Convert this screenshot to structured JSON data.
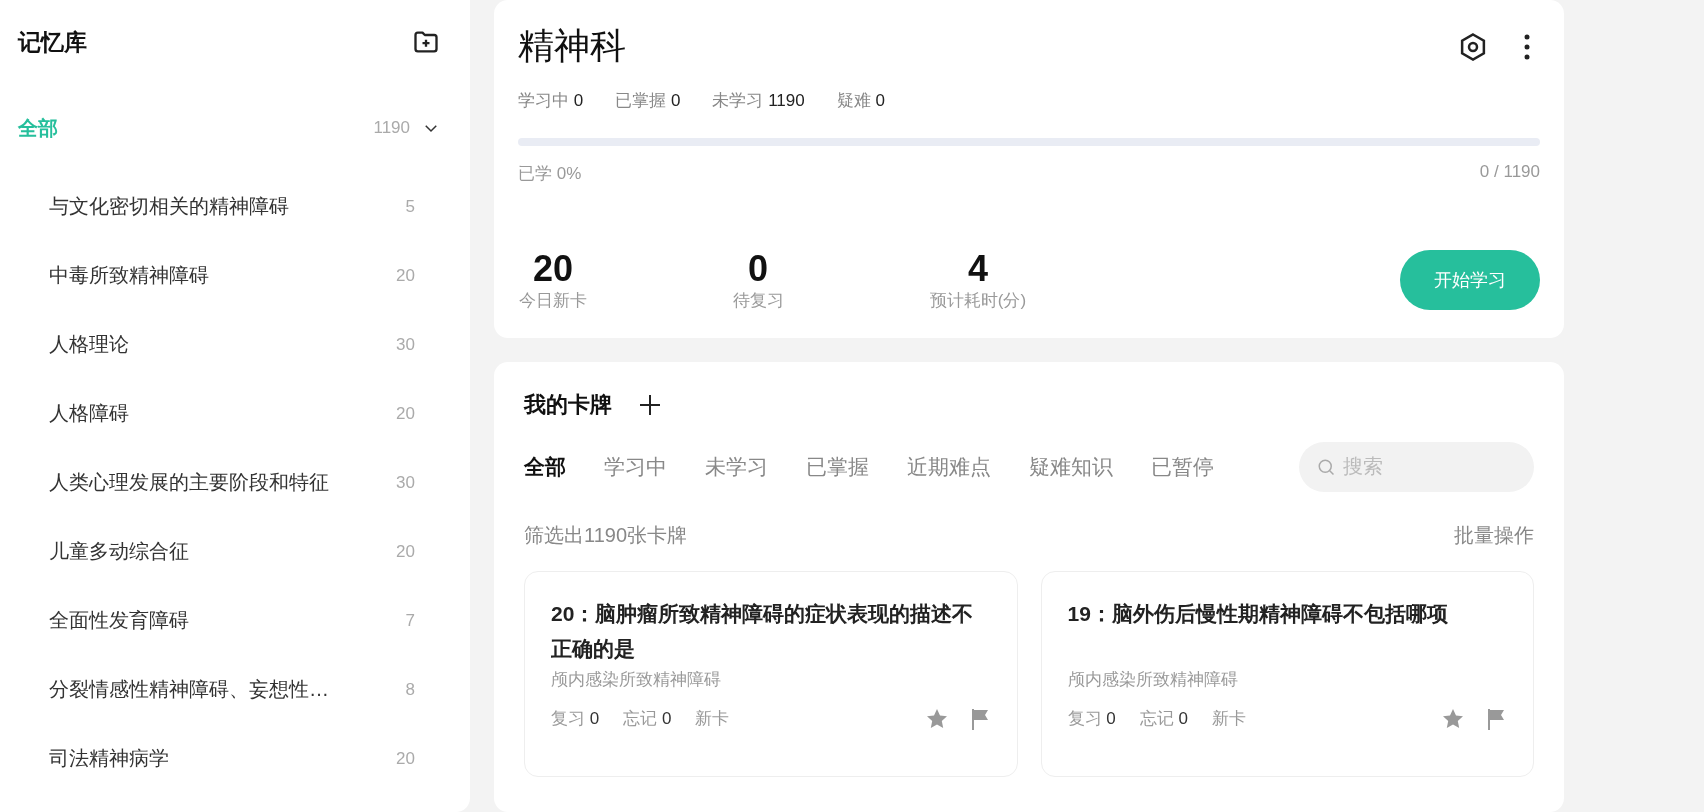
{
  "sidebar": {
    "title": "记忆库",
    "all": {
      "label": "全部",
      "count": "1190",
      "selected": true,
      "expanded": true
    },
    "items": [
      {
        "label": "与文化密切相关的精神障碍",
        "count": "5",
        "selected": false
      },
      {
        "label": "中毒所致精神障碍",
        "count": "20",
        "selected": false
      },
      {
        "label": "人格理论",
        "count": "30",
        "selected": false
      },
      {
        "label": "人格障碍",
        "count": "20",
        "selected": false
      },
      {
        "label": "人类心理发展的主要阶段和特征",
        "count": "30",
        "selected": false
      },
      {
        "label": "儿童多动综合征",
        "count": "20",
        "selected": false
      },
      {
        "label": "全面性发育障碍",
        "count": "7",
        "selected": false
      },
      {
        "label": "分裂情感性精神障碍、妄想性…",
        "count": "8",
        "selected": false
      },
      {
        "label": "司法精神病学",
        "count": "20",
        "selected": false
      }
    ]
  },
  "deck": {
    "title": "精神科",
    "stats": [
      {
        "label": "学习中",
        "value": "0"
      },
      {
        "label": "已掌握",
        "value": "0"
      },
      {
        "label": "未学习",
        "value": "1190"
      },
      {
        "label": "疑难",
        "value": "0"
      }
    ],
    "progress": {
      "level": 0,
      "label": "已学 0%",
      "reading": "0 / 1190"
    },
    "metrics": [
      {
        "value": "20",
        "label": "今日新卡"
      },
      {
        "value": "0",
        "label": "待复习"
      },
      {
        "value": "4",
        "label": "预计耗时(分)"
      }
    ],
    "start_button": "开始学习"
  },
  "cards_panel": {
    "title": "我的卡牌",
    "tabs": [
      {
        "label": "全部",
        "selected": true
      },
      {
        "label": "学习中",
        "selected": false
      },
      {
        "label": "未学习",
        "selected": false
      },
      {
        "label": "已掌握",
        "selected": false
      },
      {
        "label": "近期难点",
        "selected": false
      },
      {
        "label": "疑难知识",
        "selected": false
      },
      {
        "label": "已暂停",
        "selected": false
      }
    ],
    "search": {
      "placeholder": "搜索"
    },
    "filter_count": "筛选出1190张卡牌",
    "batch_action": "批量操作",
    "cards": [
      {
        "title": "20：脑肿瘤所致精神障碍的症状表现的描述不正确的是",
        "category": "颅内感染所致精神障碍",
        "reviews": {
          "label": "复习",
          "value": "0"
        },
        "forgets": {
          "label": "忘记",
          "value": "0"
        },
        "status": "新卡",
        "starred": false,
        "flagged": false
      },
      {
        "title": "19：脑外伤后慢性期精神障碍不包括哪项",
        "category": "颅内感染所致精神障碍",
        "reviews": {
          "label": "复习",
          "value": "0"
        },
        "forgets": {
          "label": "忘记",
          "value": "0"
        },
        "status": "新卡",
        "starred": false,
        "flagged": false
      }
    ]
  }
}
